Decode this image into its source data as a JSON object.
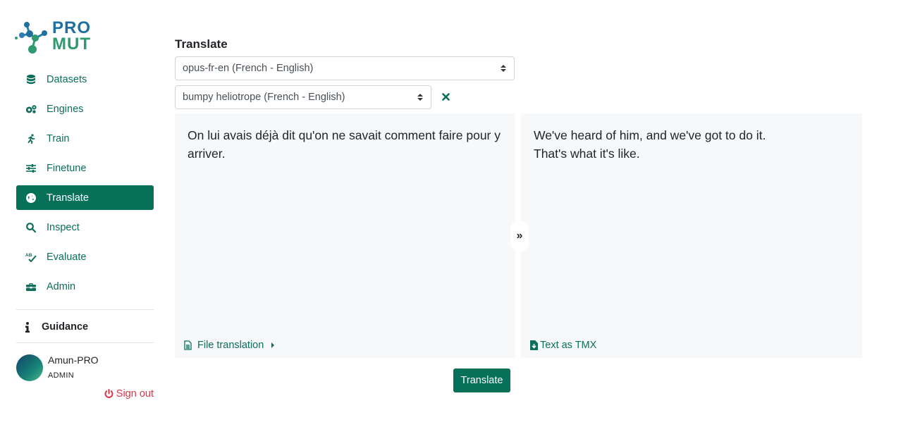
{
  "logo": {
    "line1": "PRO",
    "line2": "MUT"
  },
  "sidebar": {
    "items": [
      {
        "label": "Datasets",
        "icon": "database-icon",
        "active": false
      },
      {
        "label": "Engines",
        "icon": "gears-icon",
        "active": false
      },
      {
        "label": "Train",
        "icon": "running-icon",
        "active": false
      },
      {
        "label": "Finetune",
        "icon": "sliders-icon",
        "active": false
      },
      {
        "label": "Translate",
        "icon": "globe-icon",
        "active": true
      },
      {
        "label": "Inspect",
        "icon": "search-icon",
        "active": false
      },
      {
        "label": "Evaluate",
        "icon": "spellcheck-icon",
        "active": false
      },
      {
        "label": "Admin",
        "icon": "toolbox-icon",
        "active": false
      }
    ],
    "guidance": "Guidance",
    "user": {
      "name": "Amun-PRO",
      "role": "ADMIN"
    },
    "signout": "Sign out"
  },
  "main": {
    "title": "Translate",
    "engine_select": "opus-fr-en (French - English)",
    "memory_select": "bumpy heliotrope (French - English)",
    "source_text": "On lui avais déjà dit qu'on ne savait comment faire pour y arriver.",
    "target_text": "We've heard of him, and we've got to do it.\nThat's what it's like.",
    "swap_symbol": "»",
    "file_translation": "File translation",
    "text_as_tmx": "Text as TMX",
    "translate_button": "Translate"
  },
  "colors": {
    "accent": "#067059",
    "accent_text": "#0d6e5b",
    "danger": "#dc3545",
    "pane_bg": "#f7f8f9"
  }
}
